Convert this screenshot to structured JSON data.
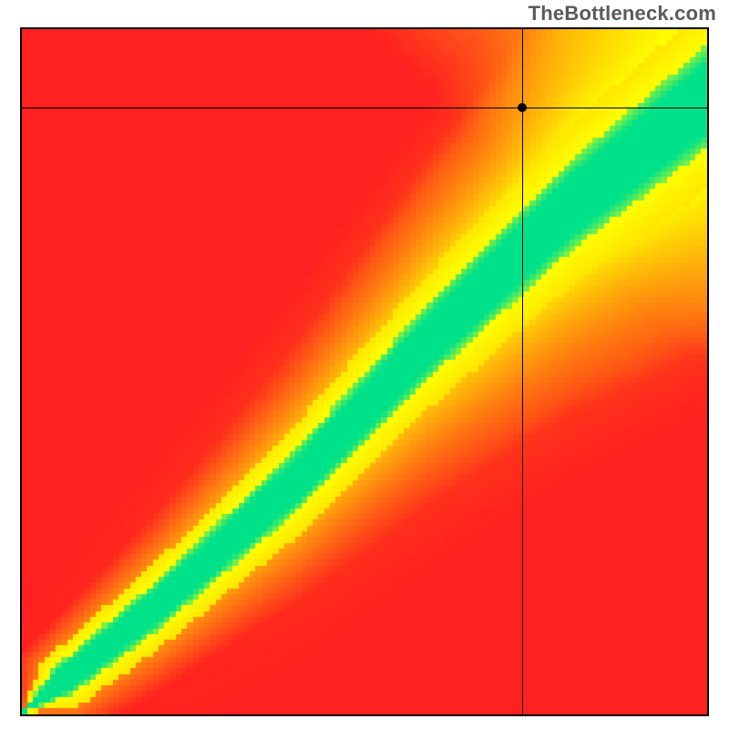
{
  "watermark": "TheBottleneck.com",
  "chart_data": {
    "type": "heatmap",
    "title": "",
    "xlabel": "",
    "ylabel": "",
    "xlim": [
      0,
      100
    ],
    "ylim": [
      0,
      100
    ],
    "color_scale": {
      "low": "#ff2020",
      "mid_low": "#ff9b00",
      "mid": "#ffff00",
      "optimal": "#00e28a",
      "description": "red = severe bottleneck, yellow = mild bottleneck, green = balanced"
    },
    "optimal_band": {
      "description": "diagonal green band where x and y are balanced; band widens slightly toward upper-right",
      "approx_center_line": [
        {
          "x": 0,
          "y": 0
        },
        {
          "x": 20,
          "y": 16
        },
        {
          "x": 40,
          "y": 34
        },
        {
          "x": 60,
          "y": 55
        },
        {
          "x": 80,
          "y": 74
        },
        {
          "x": 100,
          "y": 90
        }
      ],
      "approx_half_width_percent": 6
    },
    "crosshair": {
      "x": 73,
      "y": 88.5
    },
    "marker": {
      "x": 73,
      "y": 88.5
    }
  }
}
